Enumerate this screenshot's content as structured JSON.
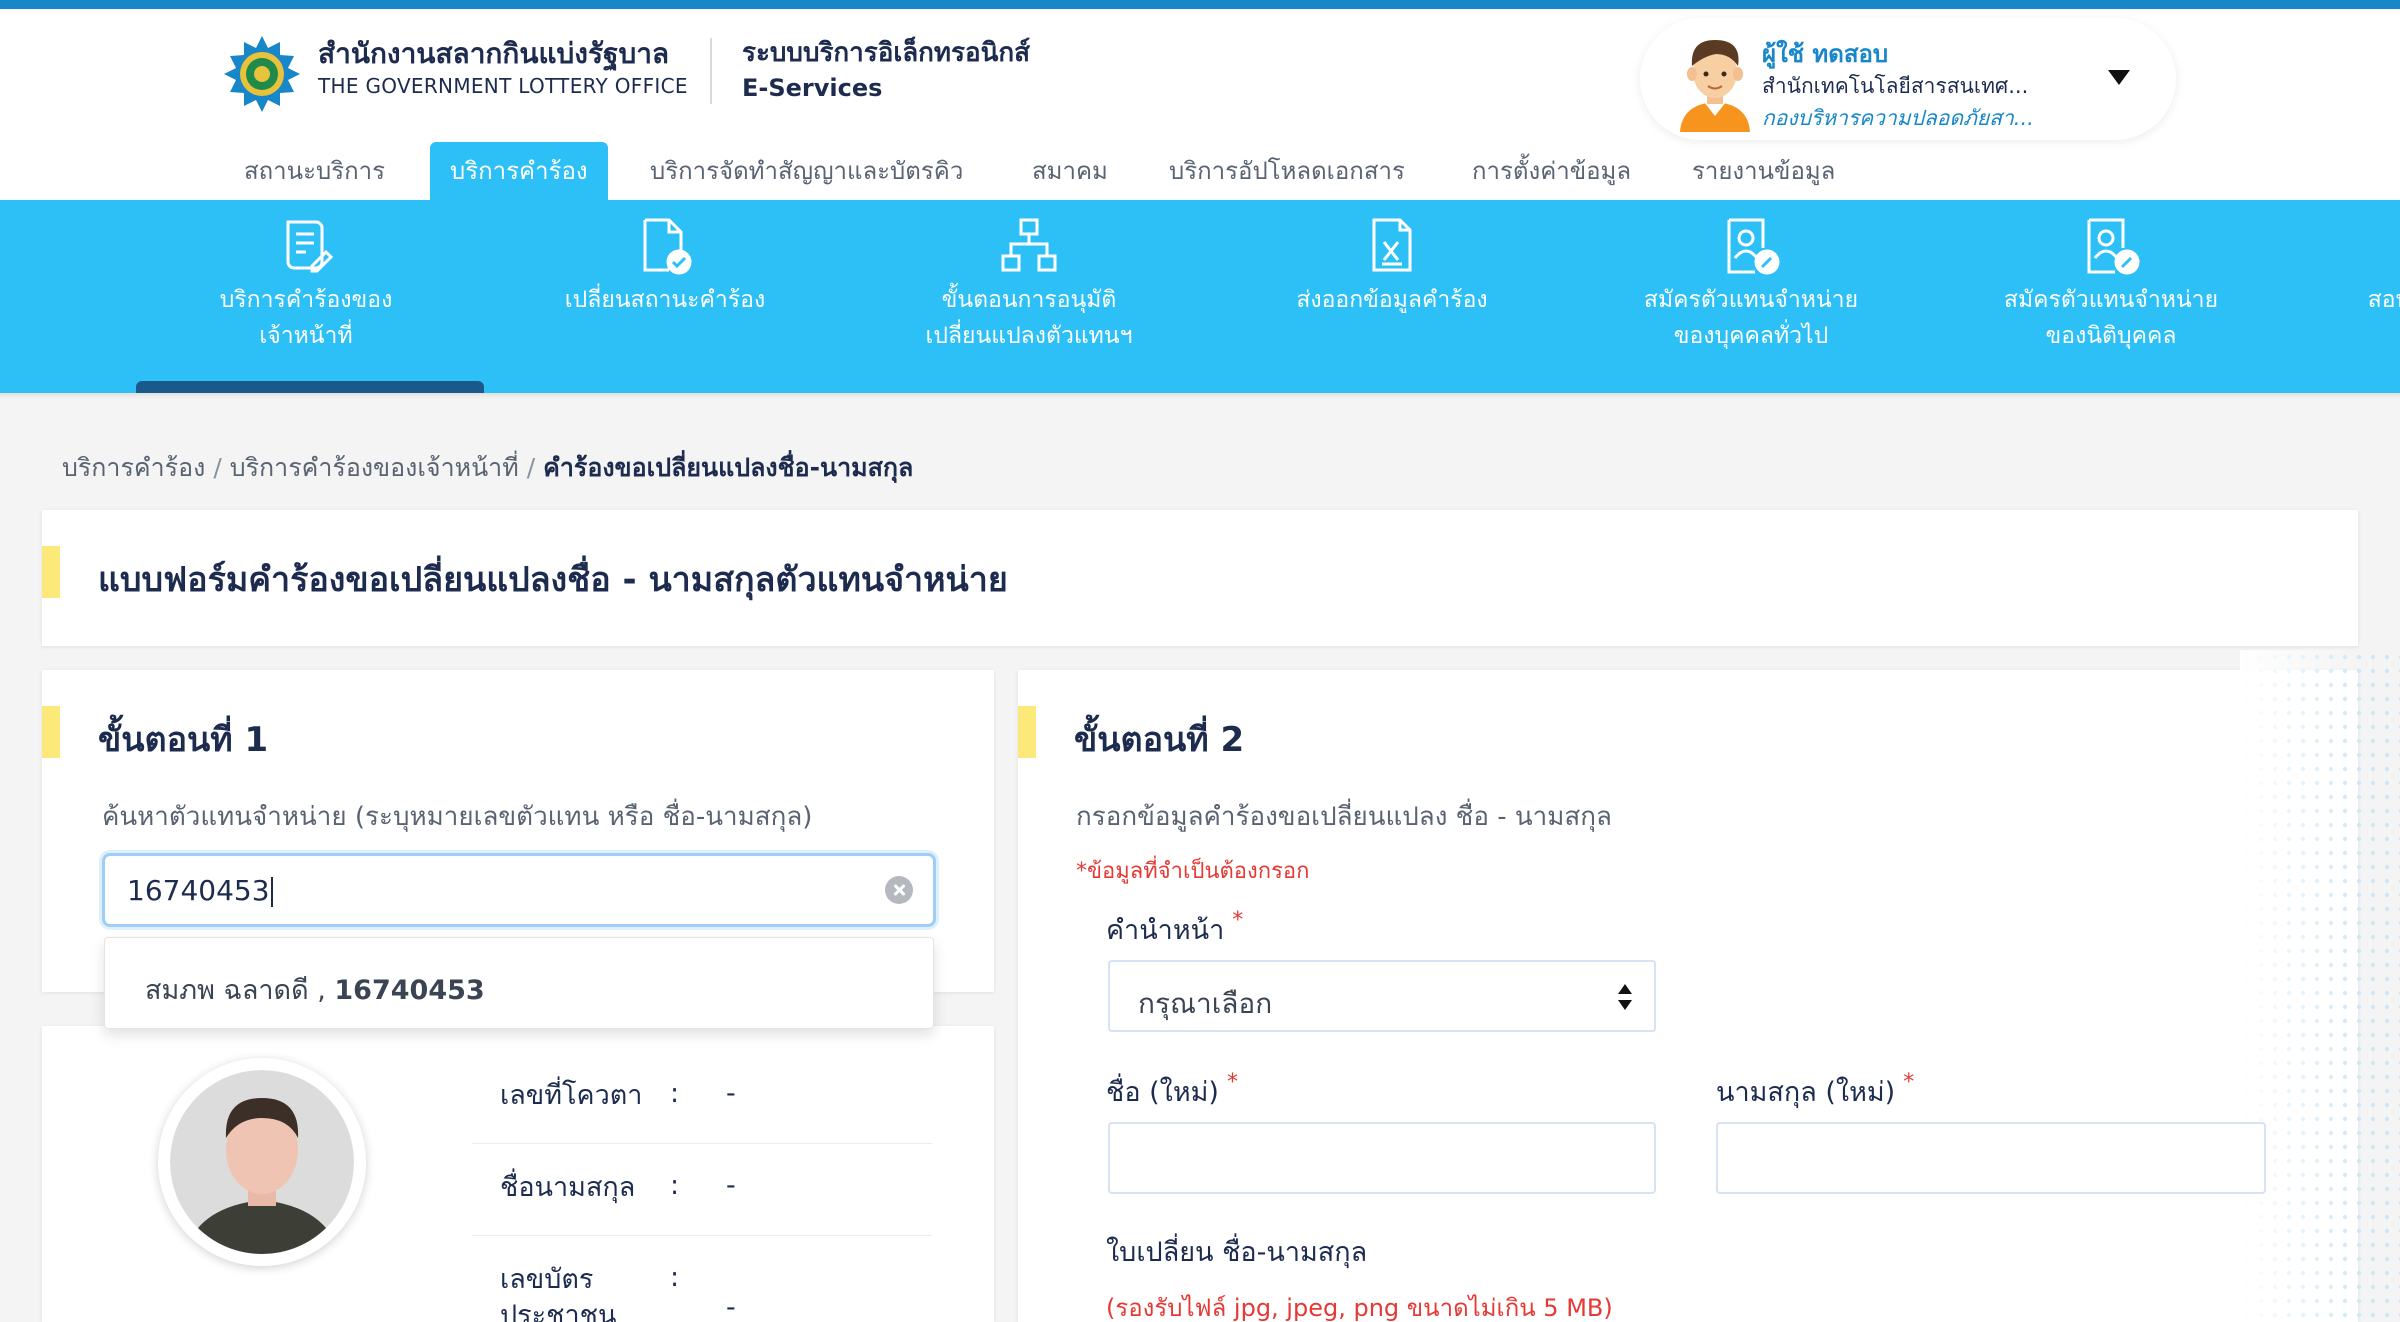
{
  "header": {
    "org_th": "สำนักงานสลากกินแบ่งรัฐบาล",
    "org_en": "THE GOVERNMENT LOTTERY OFFICE",
    "system_th": "ระบบบริการอิเล็กทรอนิกส์",
    "system_en": "E-Services"
  },
  "user": {
    "name": "ผู้ใช้ ทดสอบ",
    "department": "สำนักเทคโนโลยีสารสนเทศ...",
    "division": "กองบริหารความปลอดภัยสา..."
  },
  "tabs": [
    {
      "label": "สถานะบริการ",
      "active": false
    },
    {
      "label": "บริการคำร้อง",
      "active": true
    },
    {
      "label": "บริการจัดทำสัญญาและบัตรคิว",
      "active": false
    },
    {
      "label": "สมาคม",
      "active": false
    },
    {
      "label": "บริการอัปโหลดเอกสาร",
      "active": false
    },
    {
      "label": "การตั้งค่าข้อมูล",
      "active": false
    },
    {
      "label": "รายงานข้อมูล",
      "active": false
    }
  ],
  "subnav": [
    {
      "label": "บริการคำร้องของ\nเจ้าหน้าที่",
      "icon": "document-edit-icon",
      "active": true
    },
    {
      "label": "เปลี่ยนสถานะคำร้อง",
      "icon": "document-check-icon",
      "active": false
    },
    {
      "label": "ขั้นตอนการอนุมัติ\nเปลี่ยนแปลงตัวแทนฯ",
      "icon": "hierarchy-icon",
      "active": false
    },
    {
      "label": "ส่งออกข้อมูลคำร้อง",
      "icon": "excel-export-icon",
      "active": false
    },
    {
      "label": "สมัครตัวแทนจำหน่าย\nของบุคคลทั่วไป",
      "icon": "person-badge-edit-icon",
      "active": false
    },
    {
      "label": "สมัครตัวแทนจำหน่าย\nของนิติบุคคล",
      "icon": "person-badge-edit-icon",
      "active": false
    },
    {
      "label": "สอบถาม\nข",
      "icon": "person-badge-icon",
      "active": false
    }
  ],
  "breadcrumb": {
    "items": [
      "บริการคำร้อง",
      "บริการคำร้องของเจ้าหน้าที่"
    ],
    "current": "คำร้องขอเปลี่ยนแปลงชื่อ-นามสกุล",
    "separator": "/"
  },
  "form": {
    "title": "แบบฟอร์มคำร้องขอเปลี่ยนแปลงชื่อ - นามสกุลตัวแทนจำหน่าย"
  },
  "step1": {
    "title": "ขั้นตอนที่ 1",
    "hint": "ค้นหาตัวแทนจำหน่าย (ระบุหมายเลขตัวแทน หรือ ชื่อ-นามสกุล)",
    "search_value": "16740453",
    "suggestion_name": "สมภพ ฉลาดดี ,",
    "suggestion_id": "16740453",
    "info": [
      {
        "label": "เลขที่โควตา",
        "colon": ":",
        "value": "-"
      },
      {
        "label": "ชื่อนามสกุล",
        "colon": ":",
        "value": "-"
      },
      {
        "label": "เลขบัตร\nประชาชน",
        "colon": ":",
        "value": "-"
      }
    ]
  },
  "step2": {
    "title": "ขั้นตอนที่ 2",
    "hint": "กรอกข้อมูลคำร้องขอเปลี่ยนแปลง ชื่อ - นามสกุล",
    "required_note": "*ข้อมูลที่จำเป็นต้องกรอก",
    "prefix_label": "คำนำหน้า",
    "prefix_placeholder": "กรุณาเลือก",
    "first_name_label": "ชื่อ (ใหม่)",
    "last_name_label": "นามสกุล (ใหม่)",
    "file_label": "ใบเปลี่ยน ชื่อ-นามสกุล",
    "file_note": "(รองรับไฟล์ jpg, jpeg, png ขนาดไม่เกิน 5 MB)",
    "required_mark": "*"
  },
  "colors": {
    "accent": "#2dc0f6",
    "topbar": "#1787c9",
    "heading": "#1d2b4f",
    "required": "#e53935",
    "step_marker": "#fbe97a"
  }
}
